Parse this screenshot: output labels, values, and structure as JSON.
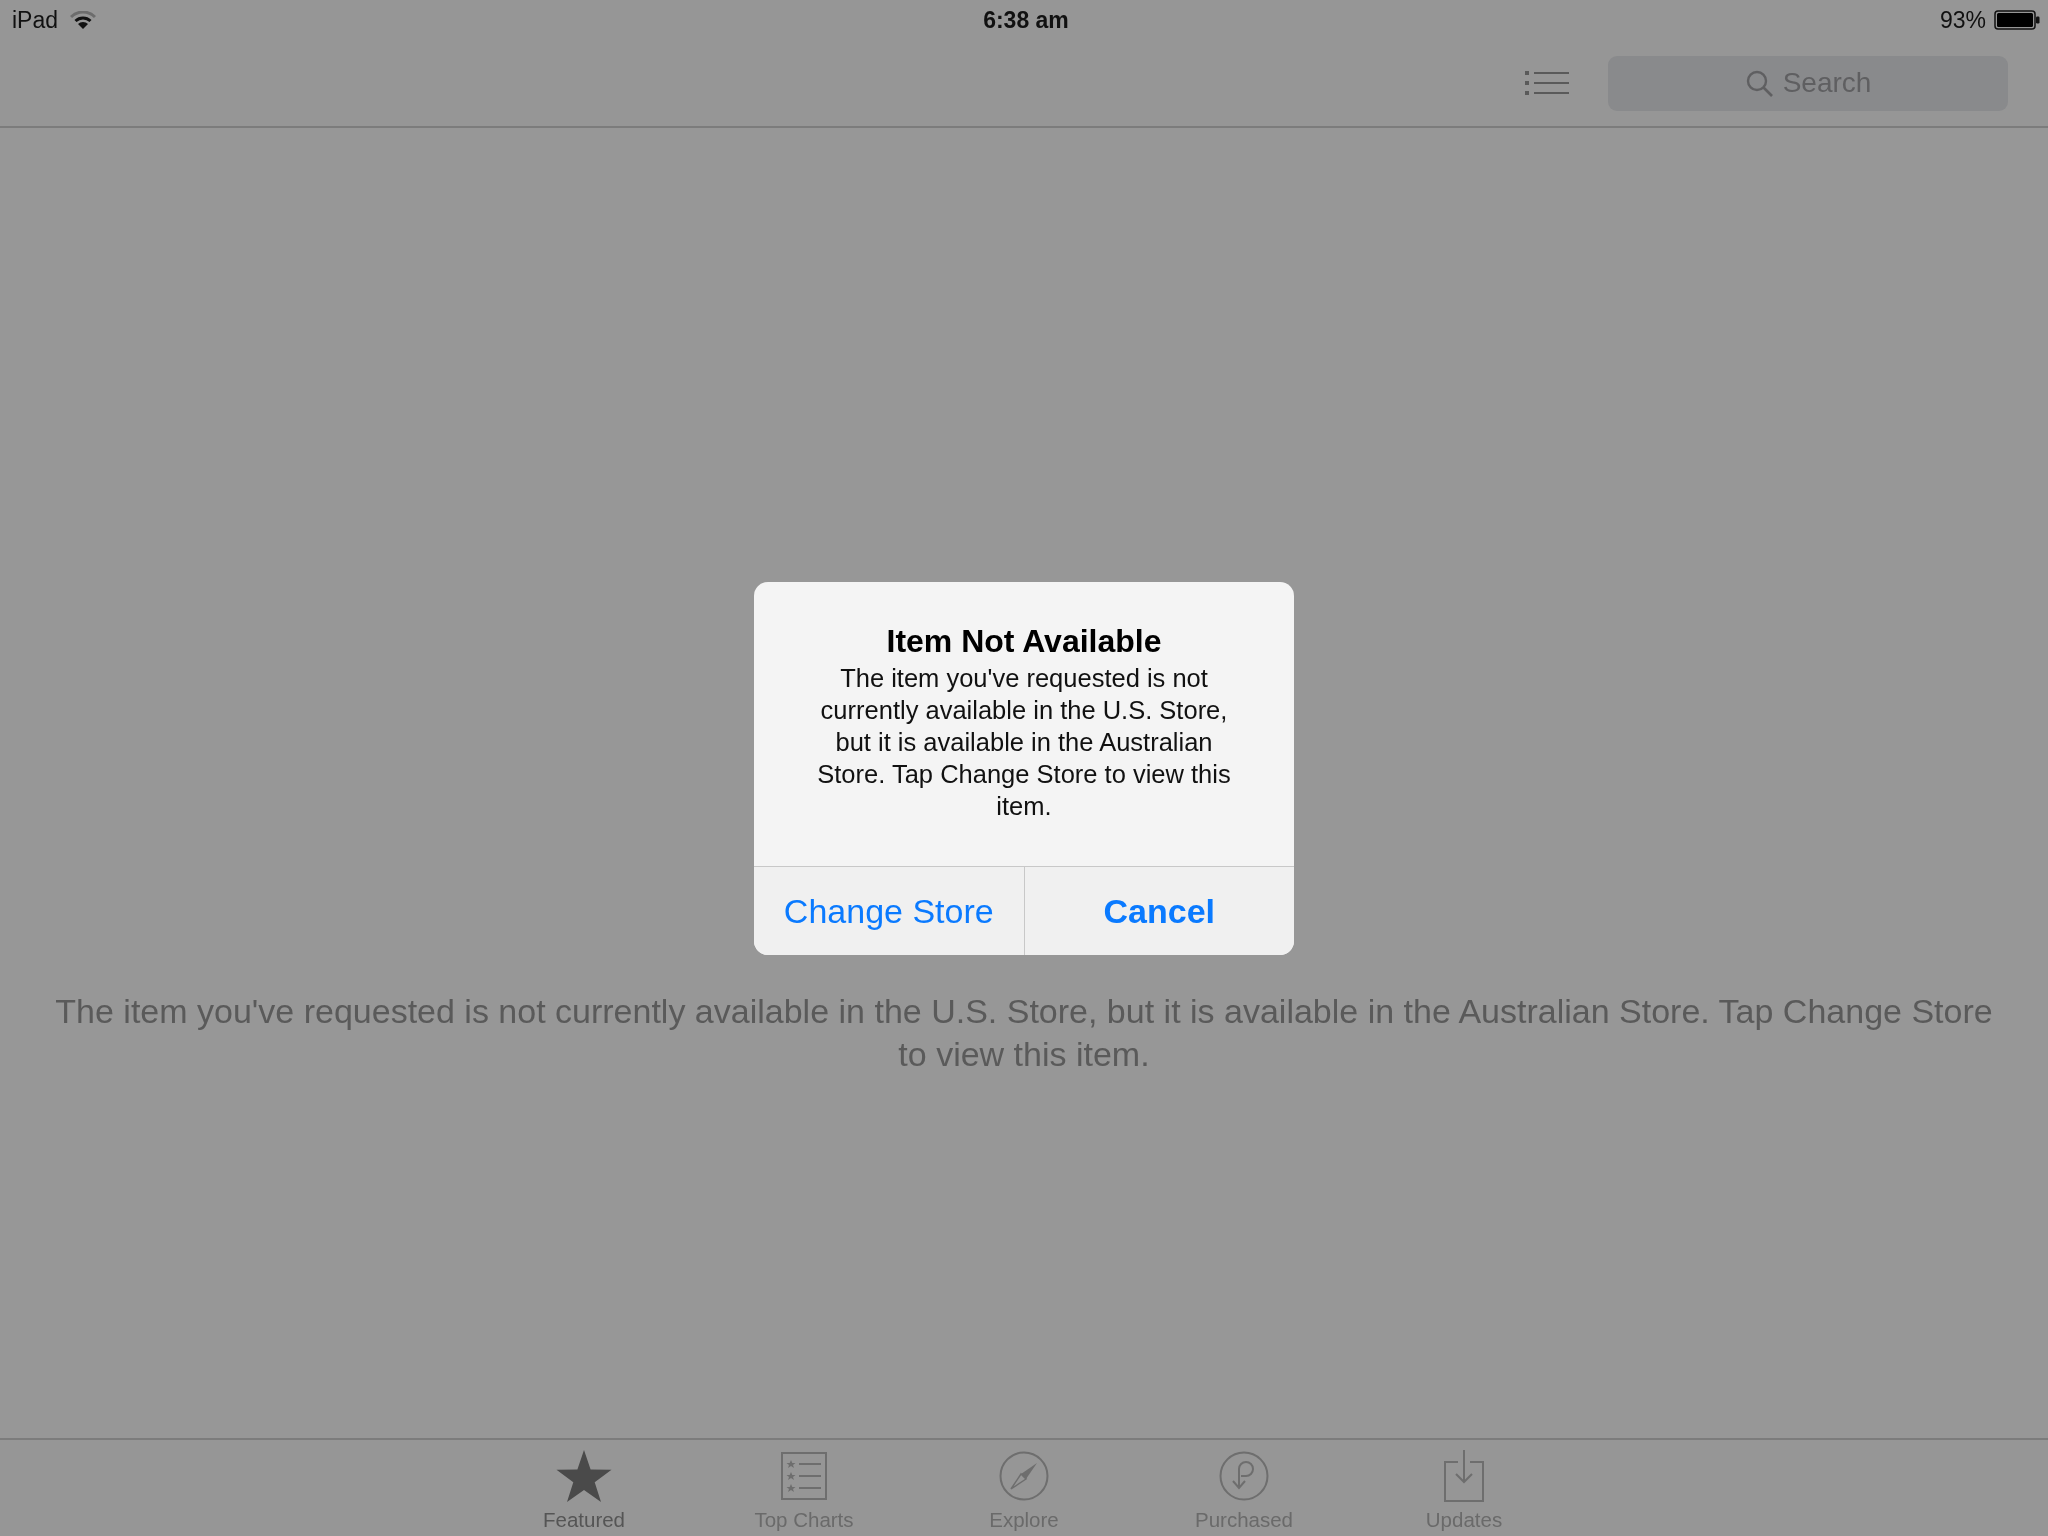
{
  "status_bar": {
    "carrier": "iPad",
    "time": "6:38 am",
    "battery": "93%"
  },
  "toolbar": {
    "search": {
      "placeholder": "Search"
    }
  },
  "content": {
    "message": "The item you've requested is not currently available in the U.S. Store, but it is available in the Australian Store. Tap Change Store to view this item."
  },
  "alert": {
    "title": "Item Not Available",
    "message": "The item you've requested is not currently available in the U.S. Store, but it is available in the Australian Store. Tap Change Store to view this item.",
    "buttons": [
      {
        "label": "Change Store",
        "kind": "action"
      },
      {
        "label": "Cancel",
        "kind": "cancel"
      }
    ]
  },
  "tab_bar": {
    "tabs": [
      {
        "label": "Featured",
        "selected": true
      },
      {
        "label": "Top Charts",
        "selected": false
      },
      {
        "label": "Explore",
        "selected": false
      },
      {
        "label": "Purchased",
        "selected": false
      },
      {
        "label": "Updates",
        "selected": false
      }
    ]
  }
}
